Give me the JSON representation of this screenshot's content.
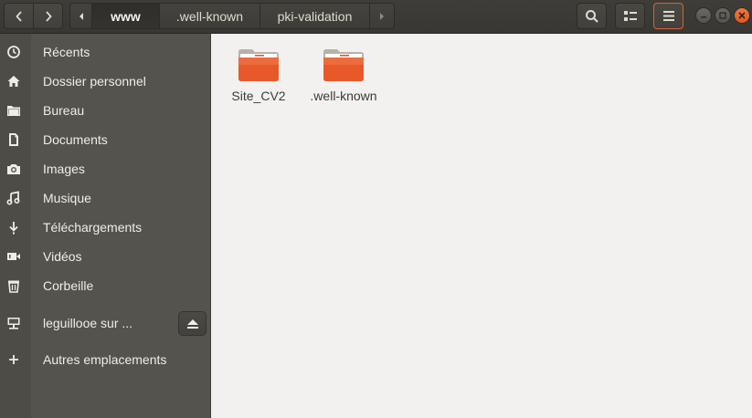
{
  "toolbar": {
    "back_icon": "chevron-left-icon",
    "forward_icon": "chevron-right-icon",
    "search_icon": "search-icon",
    "view_icon": "list-view-icon",
    "menu_icon": "hamburger-menu-icon"
  },
  "path": {
    "segments": [
      "www",
      ".well-known",
      "pki-validation"
    ],
    "active_index": 0
  },
  "sidebar": {
    "items": [
      {
        "label": "Récents",
        "icon": "clock-icon"
      },
      {
        "label": "Dossier personnel",
        "icon": "home-icon"
      },
      {
        "label": "Bureau",
        "icon": "folder-icon"
      },
      {
        "label": "Documents",
        "icon": "document-icon"
      },
      {
        "label": "Images",
        "icon": "camera-icon"
      },
      {
        "label": "Musique",
        "icon": "music-icon"
      },
      {
        "label": "Téléchargements",
        "icon": "download-icon"
      },
      {
        "label": "Vidéos",
        "icon": "video-icon"
      },
      {
        "label": "Corbeille",
        "icon": "trash-icon"
      },
      {
        "label": "leguillooe sur ...",
        "icon": "network-drive-icon"
      },
      {
        "label": "Autres emplacements",
        "icon": "plus-icon"
      }
    ]
  },
  "files": [
    {
      "name": "Site_CV2",
      "icon": "folder-icon"
    },
    {
      "name": ".well-known",
      "icon": "folder-icon"
    }
  ],
  "colors": {
    "accent": "#e95420",
    "sidebar_bg": "#55534d",
    "header_bg": "#3c3b37",
    "content_bg": "#f2f1f0"
  }
}
